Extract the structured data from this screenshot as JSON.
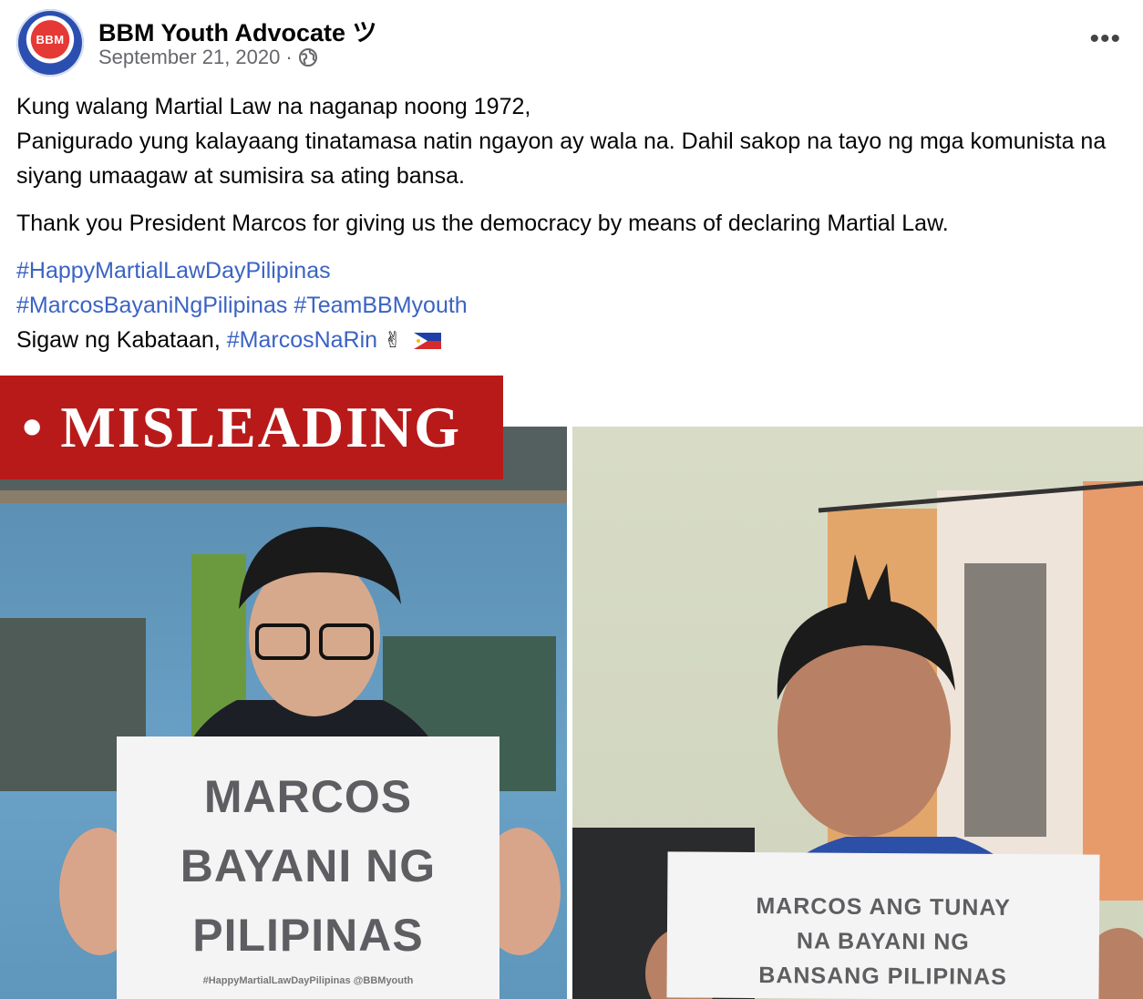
{
  "post": {
    "author": "BBM Youth Advocate ツ",
    "date": "September 21, 2020",
    "separator": "·",
    "avatar_text": "BBM",
    "more_label": "•••",
    "icons": {
      "privacy": "globe-icon",
      "more": "more-options-icon"
    }
  },
  "content": {
    "line1": "Kung walang Martial Law na naganap noong 1972,",
    "line2": "Panigurado yung kalayaang tinatamasa natin ngayon ay wala na. Dahil sakop na tayo ng mga komunista na siyang umaagaw at sumisira sa ating bansa.",
    "line3": "Thank you President Marcos for giving us the democracy by means of declaring Martial Law.",
    "hashtag1": "#HappyMartialLawDayPilipinas",
    "hashtag2": "#MarcosBayaniNgPilipinas",
    "hashtag3": "#TeamBBMyouth",
    "closing_prefix": "Sigaw ng Kabataan,",
    "hashtag4": "#MarcosNaRin",
    "emoji": "✌"
  },
  "label": {
    "text": "• MISLEADING",
    "color": "#b81a1a"
  },
  "signs": {
    "left": {
      "line1": "MARCOS",
      "line2": "BAYANI NG",
      "line3": "PILIPINAS",
      "footer": "#HappyMartialLawDayPilipinas @BBMyouth"
    },
    "right": {
      "line1": "MARCOS ANG TUNAY",
      "line2": "NA BAYANI NG",
      "line3": "BANSANG PILIPINAS"
    }
  },
  "colors": {
    "hashtag": "#3b63c4",
    "meta": "#65676b"
  }
}
